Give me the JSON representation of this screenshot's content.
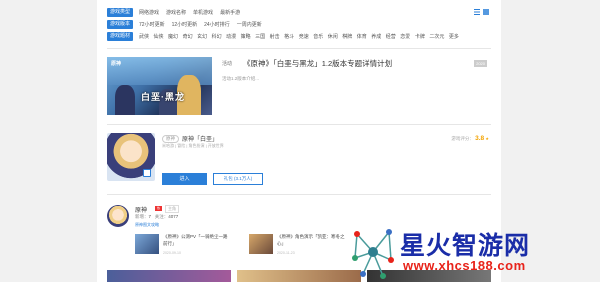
{
  "filters": [
    {
      "tag": "游戏类型",
      "options": [
        "网络游戏",
        "游戏名称",
        "单机游戏",
        "最新手游"
      ]
    },
    {
      "tag": "游戏版本",
      "options": [
        "72小时更新",
        "12小时更新",
        "24小时排行",
        "一周内更新"
      ]
    },
    {
      "tag": "游戏题材",
      "options": [
        "武侠",
        "仙侠",
        "魔幻",
        "奇幻",
        "玄幻",
        "科幻",
        "动漫",
        "策略",
        "三国",
        "射击",
        "格斗",
        "竞速",
        "音乐",
        "休闲",
        "棋牌",
        "体育",
        "养成",
        "经营",
        "恋爱",
        "卡牌",
        "二次元",
        "更多"
      ]
    }
  ],
  "news": {
    "badge": "活动",
    "title": "《原神》「白垩与黑龙」1.2版本专题详情计划",
    "sub": "活动1.2版本介绍...",
    "date": "2020",
    "banner_logo": "原神",
    "banner_text": "白垩·黑龙"
  },
  "game": {
    "pill": "原神",
    "name": "原神「白垩」",
    "meta": "米哈游 | 冒险 | 角色扮演 | 开放世界",
    "rating_label": "游戏评分：",
    "rating_value": "3.8",
    "enter_label": "进入",
    "gift_label": "礼包 (3.1万人)"
  },
  "character": {
    "name": "原神",
    "badge": "热",
    "sub": "主角",
    "stats_label": "新增：",
    "stats_value": "7",
    "stats_label2": "关注：",
    "stats_value2": "4077",
    "links": "原神图文攻略",
    "videos": [
      {
        "title": "《原神》公测PV「一骑绝尘一路前行」",
        "date": "2020-09-10"
      },
      {
        "title": "《原神》角色演示「凯亚：寒冬之心」",
        "date": "2020-11-23"
      }
    ]
  },
  "watermark": {
    "text": "星火智游网",
    "url": "www.xhcs188.com"
  },
  "colors": {
    "accent": "#2b7fd8",
    "rating": "#f3a300",
    "watermark_blue": "#1a2da8",
    "watermark_red": "#e8231a"
  }
}
